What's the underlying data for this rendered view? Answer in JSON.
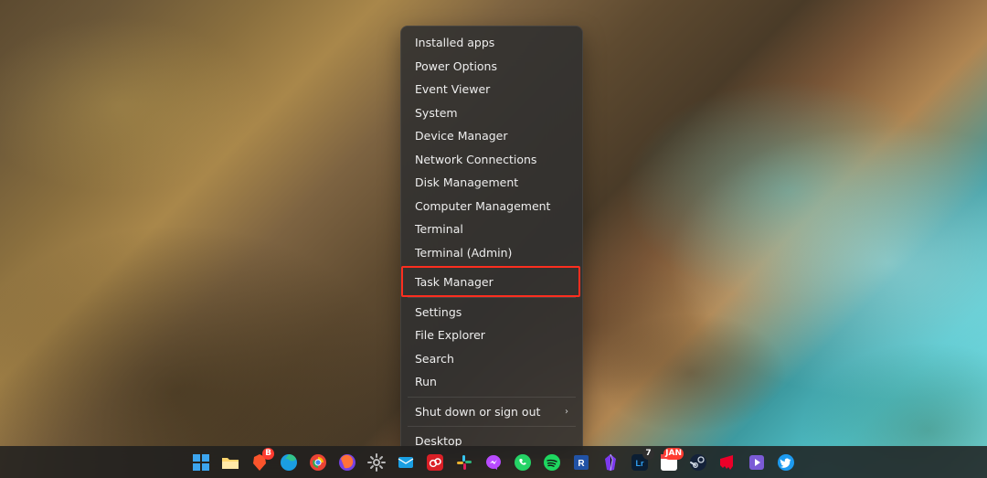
{
  "context_menu": {
    "items": [
      {
        "label": "Installed apps",
        "has_submenu": false,
        "sep_after": false
      },
      {
        "label": "Power Options",
        "has_submenu": false,
        "sep_after": false
      },
      {
        "label": "Event Viewer",
        "has_submenu": false,
        "sep_after": false
      },
      {
        "label": "System",
        "has_submenu": false,
        "sep_after": false
      },
      {
        "label": "Device Manager",
        "has_submenu": false,
        "sep_after": false
      },
      {
        "label": "Network Connections",
        "has_submenu": false,
        "sep_after": false
      },
      {
        "label": "Disk Management",
        "has_submenu": false,
        "sep_after": false
      },
      {
        "label": "Computer Management",
        "has_submenu": false,
        "sep_after": false
      },
      {
        "label": "Terminal",
        "has_submenu": false,
        "sep_after": false
      },
      {
        "label": "Terminal (Admin)",
        "has_submenu": false,
        "sep_after": true
      },
      {
        "label": "Task Manager",
        "has_submenu": false,
        "sep_after": true
      },
      {
        "label": "Settings",
        "has_submenu": false,
        "sep_after": false
      },
      {
        "label": "File Explorer",
        "has_submenu": false,
        "sep_after": false
      },
      {
        "label": "Search",
        "has_submenu": false,
        "sep_after": false
      },
      {
        "label": "Run",
        "has_submenu": false,
        "sep_after": true
      },
      {
        "label": "Shut down or sign out",
        "has_submenu": true,
        "sep_after": true
      },
      {
        "label": "Desktop",
        "has_submenu": false,
        "sep_after": false
      }
    ],
    "highlighted_index": 10
  },
  "taskbar": {
    "icons": [
      {
        "name": "start-icon",
        "badge": null
      },
      {
        "name": "file-explorer-icon",
        "badge": null
      },
      {
        "name": "brave-icon",
        "badge": "B"
      },
      {
        "name": "edge-icon",
        "badge": null
      },
      {
        "name": "chrome-icon",
        "badge": null
      },
      {
        "name": "firefox-icon",
        "badge": null
      },
      {
        "name": "settings-icon",
        "badge": null
      },
      {
        "name": "mail-icon",
        "badge": null
      },
      {
        "name": "adobe-cc-icon",
        "badge": null
      },
      {
        "name": "slack-icon",
        "badge": null
      },
      {
        "name": "messenger-icon",
        "badge": null
      },
      {
        "name": "whatsapp-icon",
        "badge": null
      },
      {
        "name": "spotify-icon",
        "badge": null
      },
      {
        "name": "revit-icon",
        "badge": null
      },
      {
        "name": "obsidian-icon",
        "badge": null
      },
      {
        "name": "lightroom-icon",
        "badge": "7"
      },
      {
        "name": "jan-icon",
        "badge": "JAN"
      },
      {
        "name": "steam-icon",
        "badge": null
      },
      {
        "name": "riot-icon",
        "badge": null
      },
      {
        "name": "stremio-icon",
        "badge": null
      },
      {
        "name": "twitter-icon",
        "badge": null
      }
    ]
  }
}
